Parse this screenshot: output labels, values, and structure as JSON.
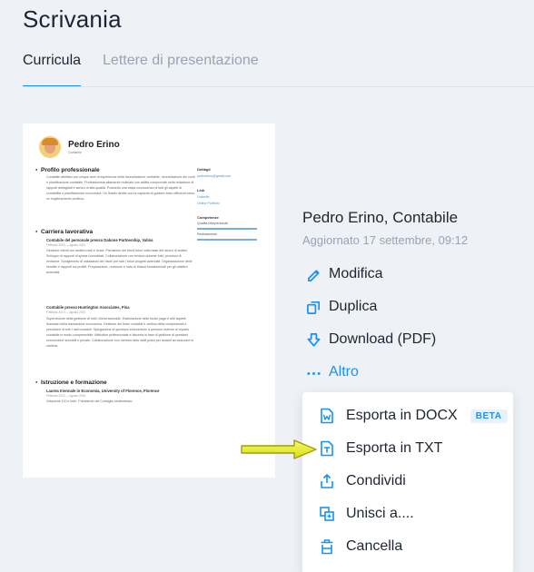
{
  "header": {
    "title": "Scrivania"
  },
  "tabs": [
    {
      "label": "Curricula",
      "active": true
    },
    {
      "label": "Lettere di presentazione",
      "active": false
    }
  ],
  "resume_preview": {
    "name": "Pedro Erino",
    "role": "Contabile",
    "sections": {
      "profile": {
        "heading": "Profilo professionale",
        "text": "Contabile abilitato con cinque anni di esperienza nella riconciliazione contabile, riconciliazione dei conti e pianificazione contabile. Professionista altamente motivato con abilità comprovate nella redazione di rapporti dettagliati e servizi di alta qualità. Possiedo una vasta conoscenza di tutti gli aspetti di contabilità e pianificazione economica. Un leader dedito con la capacità di guidare team efficienti verso un miglioramento proficuo."
      },
      "career": {
        "heading": "Carriera lavorativa",
        "job1_title": "Contabile del personale presso Dabone Partnership, Valina",
        "job1_date": "Febbraio 2016 — agosto 2021",
        "job1_text": "Gestione clienti con analisi costi e ricavi. Previsione dei trend futuri sulla base del lavoro di analisi. Sviluppo di rapporti di spesa consolidati. Collaborazione con revisori durante tutti i processi di revisione. Svolgimento di valutazioni dei rischi per tutti i futuri progetti aziendali. Organizzazione delle vendite e rapporti sui profitti. Preparazione, revisione e invio di bilanci fondamentali per gli obiettivi aziendali.",
        "job2_title": "Contabile presso Huntington Associates, Pisa",
        "job2_date": "Febbraio 2013 — agosto 2015",
        "job2_text": "Supervisione della gestione di tutti i clienti aziendali. Elaborazione delle buste paga e altri aspetti finanziari della transazione economica. Gestione dei team contabili e verifica della completezza e precisione di tutti i dati contabili. Spiegazione di questioni economiche a persone esterne al reparto contabile in modo comprensibile. Attitudine professionale e discreta in fase di gestione di questioni economiche sensibili e private. Collaborazione con membri dello staff junior per aiutarli ad avanzare in carriera."
      },
      "education": {
        "heading": "Istruzione e formazione",
        "degree": "Laurea triennale in Economia, University of Florence, Florence",
        "date": "Febbraio 2014 — agosto 2016",
        "text": "Votazione 110 e lode. Presidente del Consiglio studentesco."
      }
    },
    "sidebar": {
      "details_heading": "Dettagli",
      "email": "pedroerino@gmail.com",
      "links_heading": "Link",
      "link1": "LinkedIn",
      "link2": "Online Portfolio",
      "skills_heading": "Competenze",
      "skill1": "Qualità interpersonali",
      "skill2": "Reclutamento"
    }
  },
  "document": {
    "title": "Pedro Erino, Contabile",
    "updated": "Aggiornato 17 settembre, 09:12"
  },
  "actions": {
    "edit": "Modifica",
    "duplicate": "Duplica",
    "download": "Download (PDF)",
    "more": "Altro"
  },
  "menu": {
    "export_docx": "Esporta in DOCX",
    "beta_badge": "BETA",
    "export_txt": "Esporta in TXT",
    "share": "Condividi",
    "merge": "Unisci a....",
    "delete": "Cancella"
  },
  "colors": {
    "accent": "#1a91f0",
    "text_primary": "#1e2532",
    "text_muted": "#9aa3b2",
    "background": "#eef1f6",
    "pointer_arrow": "#e6ec1c"
  },
  "icons": {
    "edit": "pencil-icon",
    "duplicate": "duplicate-icon",
    "download": "download-arrow-icon",
    "more": "ellipsis-icon",
    "export_docx": "word-doc-icon",
    "export_txt": "text-doc-icon",
    "share": "share-icon",
    "merge": "merge-icon",
    "delete": "trash-icon"
  }
}
